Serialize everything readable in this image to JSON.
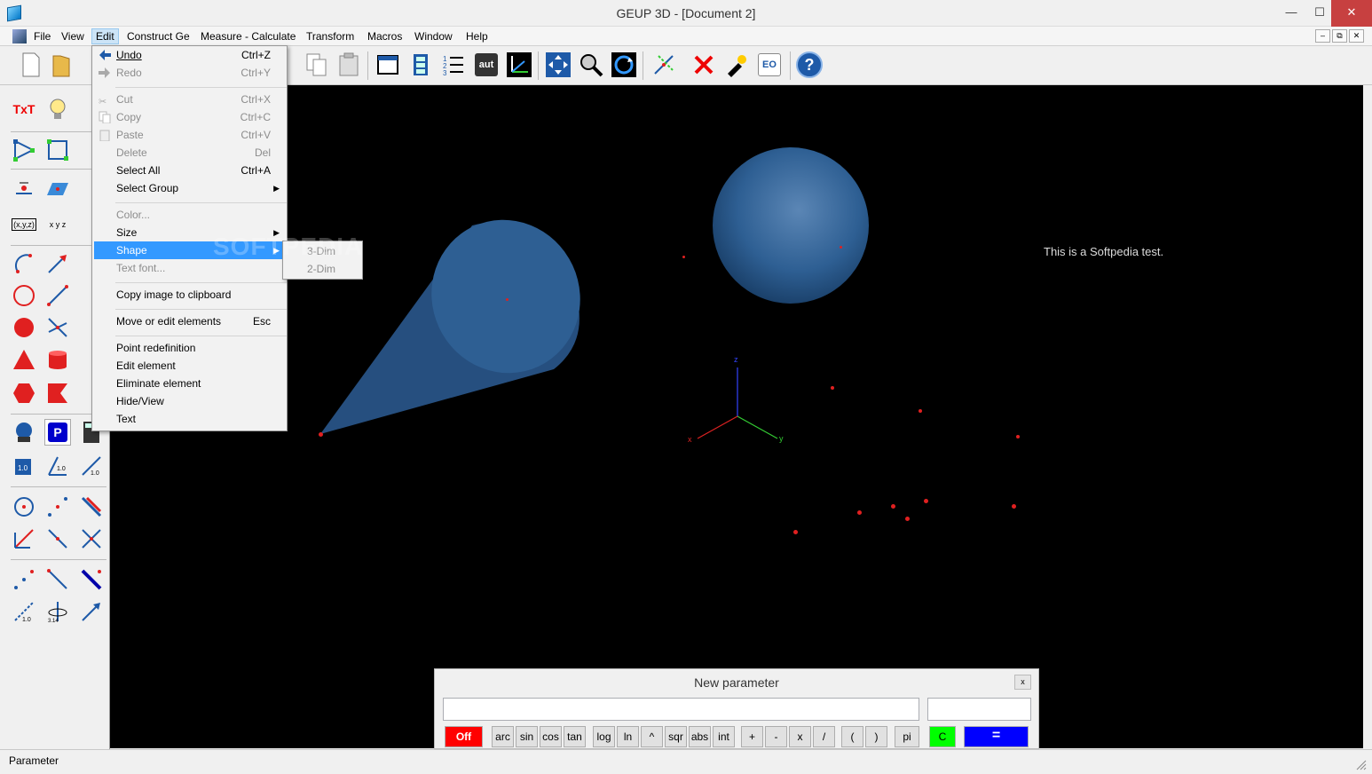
{
  "window": {
    "title": "GEUP 3D - [Document 2]",
    "minimize": "—",
    "maximize": "☐",
    "close": "✕"
  },
  "menubar": {
    "items": [
      "File",
      "View",
      "Edit",
      "Construct Ge",
      "Measure - Calculate",
      "Transform",
      "Macros",
      "Window",
      "Help"
    ],
    "mdi": [
      "–",
      "⧉",
      "✕"
    ]
  },
  "edit_menu": {
    "undo": {
      "label": "Undo",
      "shortcut": "Ctrl+Z"
    },
    "redo": {
      "label": "Redo",
      "shortcut": "Ctrl+Y"
    },
    "cut": {
      "label": "Cut",
      "shortcut": "Ctrl+X"
    },
    "copy": {
      "label": "Copy",
      "shortcut": "Ctrl+C"
    },
    "paste": {
      "label": "Paste",
      "shortcut": "Ctrl+V"
    },
    "delete": {
      "label": "Delete",
      "shortcut": "Del"
    },
    "select_all": {
      "label": "Select All",
      "shortcut": "Ctrl+A"
    },
    "select_group": {
      "label": "Select Group"
    },
    "color": {
      "label": "Color..."
    },
    "size": {
      "label": "Size"
    },
    "shape": {
      "label": "Shape"
    },
    "text_font": {
      "label": "Text font..."
    },
    "copy_image": {
      "label": "Copy image to clipboard"
    },
    "move_edit": {
      "label": "Move or edit elements",
      "shortcut": "Esc"
    },
    "point_redef": {
      "label": "Point redefinition"
    },
    "edit_element": {
      "label": "Edit element"
    },
    "eliminate": {
      "label": "Eliminate element"
    },
    "hide_view": {
      "label": "Hide/View"
    },
    "text": {
      "label": "Text"
    },
    "submenu_arrow": "▶"
  },
  "shape_submenu": {
    "dim3": "3-Dim",
    "dim2": "2-Dim"
  },
  "watermark": "SOFTPEDIA",
  "canvas": {
    "note": "This is a Softpedia test.",
    "axis_z": "z",
    "axis_x": "x",
    "axis_y": "y"
  },
  "parameter_window": {
    "title": "New parameter",
    "close": "x",
    "expression_value": "",
    "result_value": "",
    "buttons": {
      "off": "Off",
      "arc": "arc",
      "sin": "sin",
      "cos": "cos",
      "tan": "tan",
      "log": "log",
      "ln": "ln",
      "pow": "^",
      "sqr": "sqr",
      "abs": "abs",
      "int": "int",
      "plus": "+",
      "minus": "-",
      "times": "x",
      "div": "/",
      "lparen": "(",
      "rparen": ")",
      "pi": "pi",
      "clear": "C",
      "equals": "="
    }
  },
  "leftbar": {
    "text_tool": "TxT",
    "coords_label": "(x,y,z)",
    "xyz_label": "x y z",
    "param_label": "P",
    "value_label": "1.0"
  },
  "toolbar": {
    "auto_label": "aut",
    "eo_label": "EO",
    "help_label": "?"
  },
  "statusbar": {
    "text": "Parameter"
  },
  "colors": {
    "menu_highlight": "#3399ff",
    "canvas_bg": "#000000",
    "point": "#e02020",
    "solid": "#2e5f93",
    "off_button": "#ff0000",
    "clear_button": "#00ff00",
    "equals_button": "#0000ff"
  }
}
